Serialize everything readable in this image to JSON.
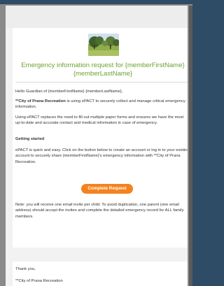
{
  "email": {
    "headline": "Emergency information request for {memberFirstName} {memberLastName}",
    "greeting": "Hello Guardian of {memberFirstName} {memberLastName},",
    "org_bold": "**City of Prana Recreation",
    "intro_rest": " is using ePACT to securely collect and manage critical emergency information.",
    "paragraph2": "Using ePACT replaces the need to fill out multiple paper forms and ensures we have the most up-to-date and accurate contact and medical information in case of emergency.",
    "getting_started": "Getting started",
    "paragraph3": "ePACT is quick and easy. Click on the button below to create an account or log in to your existing account to securely share {memberFirstName}'s emergency information with **City of Prana Recreation.",
    "button_label": "Complete Request",
    "note": "Note: you will receive one email invite per child. To avoid duplication, one parent (one email address) should accept the invites and complete the detailed emergency record for ALL family members.",
    "thanks": "Thank you,",
    "signature": "**City of Prana Recreation"
  },
  "colors": {
    "headline": "#6aa330",
    "button": "#f5821f",
    "header_bar": "#2f4c67"
  },
  "icons": {
    "hero": "park-landscape-image"
  }
}
